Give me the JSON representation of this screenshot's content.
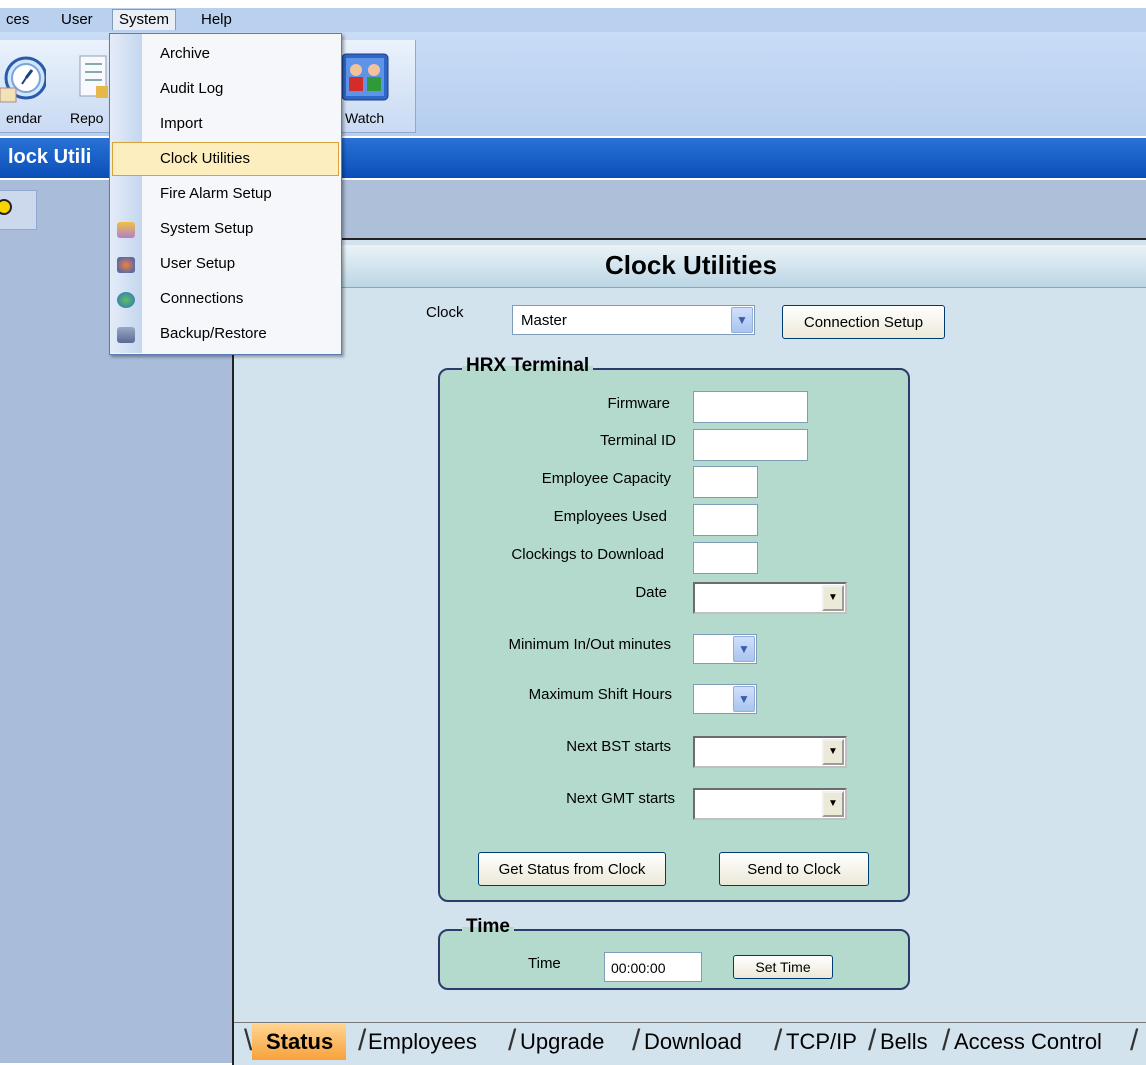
{
  "menubar": {
    "items": [
      {
        "label": "ces"
      },
      {
        "label": "User"
      },
      {
        "label": "System"
      },
      {
        "label": "Help"
      }
    ]
  },
  "toolbar": {
    "calendar_label": "endar",
    "reports_label": "Repo",
    "watch_label": "Watch"
  },
  "titlebar": {
    "text": "lock Utili"
  },
  "system_menu": {
    "items": [
      {
        "label": "Archive"
      },
      {
        "label": "Audit Log"
      },
      {
        "label": "Import"
      },
      {
        "label": "Clock Utilities"
      },
      {
        "label": "Fire Alarm Setup"
      },
      {
        "label": "System Setup"
      },
      {
        "label": "User Setup"
      },
      {
        "label": "Connections"
      },
      {
        "label": "Backup/Restore"
      }
    ]
  },
  "page": {
    "title": "Clock Utilities",
    "clock_label": "Clock",
    "clock_value": "Master",
    "connection_setup": "Connection Setup"
  },
  "hrx": {
    "title": "HRX Terminal",
    "firmware": "Firmware",
    "terminal_id": "Terminal ID",
    "employee_capacity": "Employee Capacity",
    "employees_used": "Employees Used",
    "clockings": "Clockings to Download",
    "date": "Date",
    "min_inout": "Minimum In/Out minutes",
    "max_shift": "Maximum Shift Hours",
    "next_bst": "Next BST starts",
    "next_gmt": "Next GMT starts",
    "get_status": "Get Status from Clock",
    "send_to_clock": "Send to Clock"
  },
  "time_group": {
    "title": "Time",
    "time_label": "Time",
    "time_value": "00:00:00",
    "set_time": "Set Time"
  },
  "tabs": [
    {
      "label": "Status"
    },
    {
      "label": "Employees"
    },
    {
      "label": "Upgrade"
    },
    {
      "label": "Download"
    },
    {
      "label": "TCP/IP"
    },
    {
      "label": "Bells"
    },
    {
      "label": "Access Control"
    }
  ]
}
